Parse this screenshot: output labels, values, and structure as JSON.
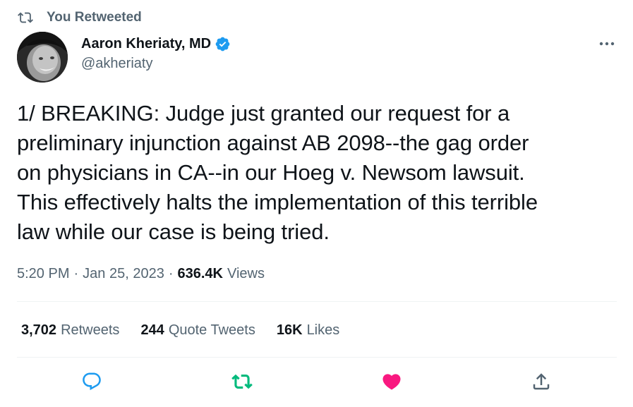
{
  "retweet_banner": {
    "label": "You Retweeted"
  },
  "author": {
    "name": "Aaron Kheriaty, MD",
    "handle": "@akheriaty",
    "verified": true
  },
  "tweet": {
    "text": "1/ BREAKING: Judge just granted our request for a\npreliminary injunction against AB 2098--the gag order\non physicians in CA--in our Hoeg v. Newsom lawsuit.\nThis effectively halts the implementation of this terrible\nlaw while our case is being tried.",
    "time": "5:20 PM",
    "date": "Jan 25, 2023",
    "views_count": "636.4K",
    "views_label": "Views"
  },
  "stats": {
    "retweets": {
      "count": "3,702",
      "label": "Retweets"
    },
    "quote_tweets": {
      "count": "244",
      "label": "Quote Tweets"
    },
    "likes": {
      "count": "16K",
      "label": "Likes"
    }
  },
  "actions": {
    "retweeted": true,
    "liked": true
  },
  "colors": {
    "retweet_green": "#00ba7c",
    "like_pink": "#f91880",
    "verified_blue": "#1d9bf0",
    "secondary_text": "#536471",
    "action_blue": "#1d9bf0"
  },
  "icons": {
    "retweet_banner": "retweet-icon",
    "verified": "verified-badge-icon",
    "more": "more-dots-icon",
    "reply": "reply-icon",
    "retweet": "retweet-icon",
    "like": "heart-icon",
    "share": "share-icon"
  }
}
